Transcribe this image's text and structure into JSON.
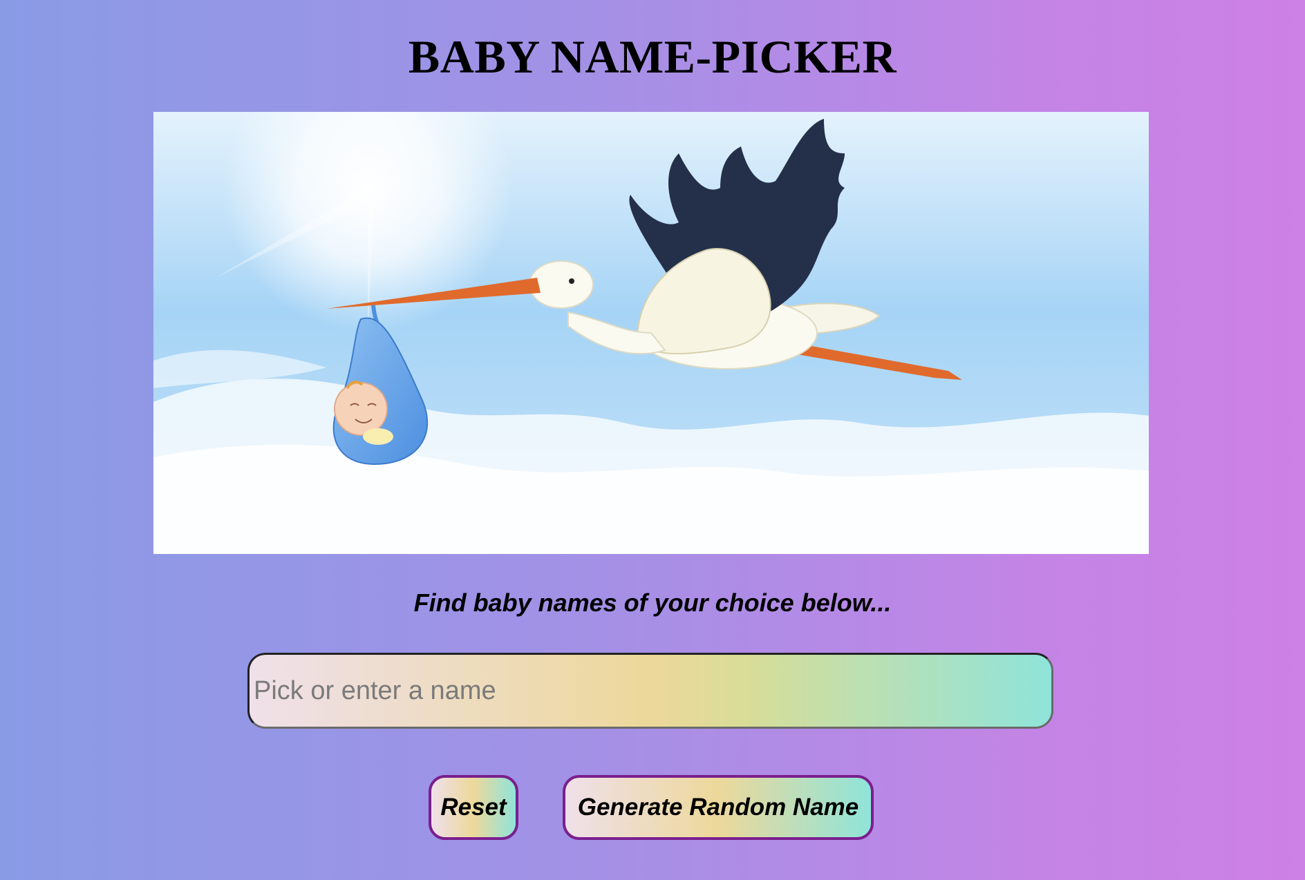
{
  "header": {
    "title": "BABY NAME-PICKER"
  },
  "hero": {
    "icon": "stork-carrying-baby-illustration"
  },
  "main": {
    "tagline": "Find baby names of your choice below...",
    "name_input": {
      "value": "",
      "placeholder": "Pick or enter a name"
    },
    "buttons": {
      "reset_label": "Reset",
      "random_label": "Generate Random Name"
    }
  },
  "colors": {
    "background_start": "#8a9be6",
    "background_end": "#cd80e6",
    "button_border": "#7a1f8e",
    "input_gradient": [
      "#efe0ea",
      "#edd89a",
      "#8fe4da"
    ]
  }
}
